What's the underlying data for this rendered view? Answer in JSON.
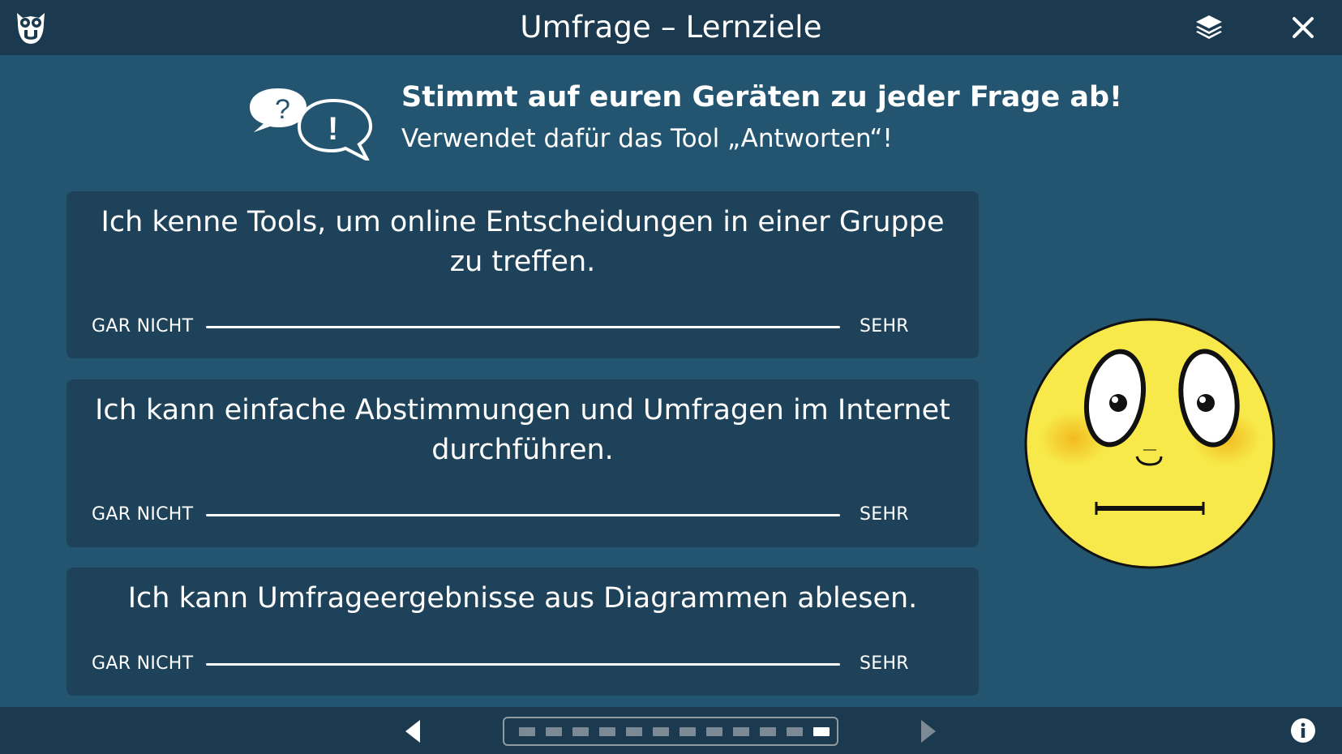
{
  "app": {
    "title": "Umfrage – Lernziele"
  },
  "toolbar": {
    "logo_icon": "owl-logo-icon",
    "layers_icon": "layers-icon",
    "close_icon": "close-icon"
  },
  "instruction": {
    "icon": "speech-bubbles-icon",
    "headline": "Stimmt auf euren Geräten zu jeder Frage ab!",
    "subline": "Verwendet dafür das Tool „Antworten“!"
  },
  "questions": [
    {
      "text": "Ich kenne Tools, um online Entscheidungen in einer Gruppe zu treffen.",
      "scale_min": "GAR NICHT",
      "scale_max": "SEHR"
    },
    {
      "text": "Ich kann einfache Abstimmungen und Umfragen im Internet durchführen.",
      "scale_min": "GAR NICHT",
      "scale_max": "SEHR"
    },
    {
      "text": "Ich kann Umfrageergebnisse aus Diagrammen ablesen.",
      "scale_min": "GAR NICHT",
      "scale_max": "SEHR"
    }
  ],
  "emoji": {
    "icon": "neutral-face-emoji"
  },
  "navigation": {
    "prev_icon": "triangle-left-icon",
    "next_icon": "triangle-right-icon",
    "info_icon": "info-icon",
    "page_count": 12,
    "current_page": 12
  },
  "colors": {
    "background": "#235570",
    "bar": "#1b3a4f",
    "card": "#1d4259",
    "emoji_yellow": "#f7e94a",
    "emoji_blush": "#f2b81c"
  }
}
